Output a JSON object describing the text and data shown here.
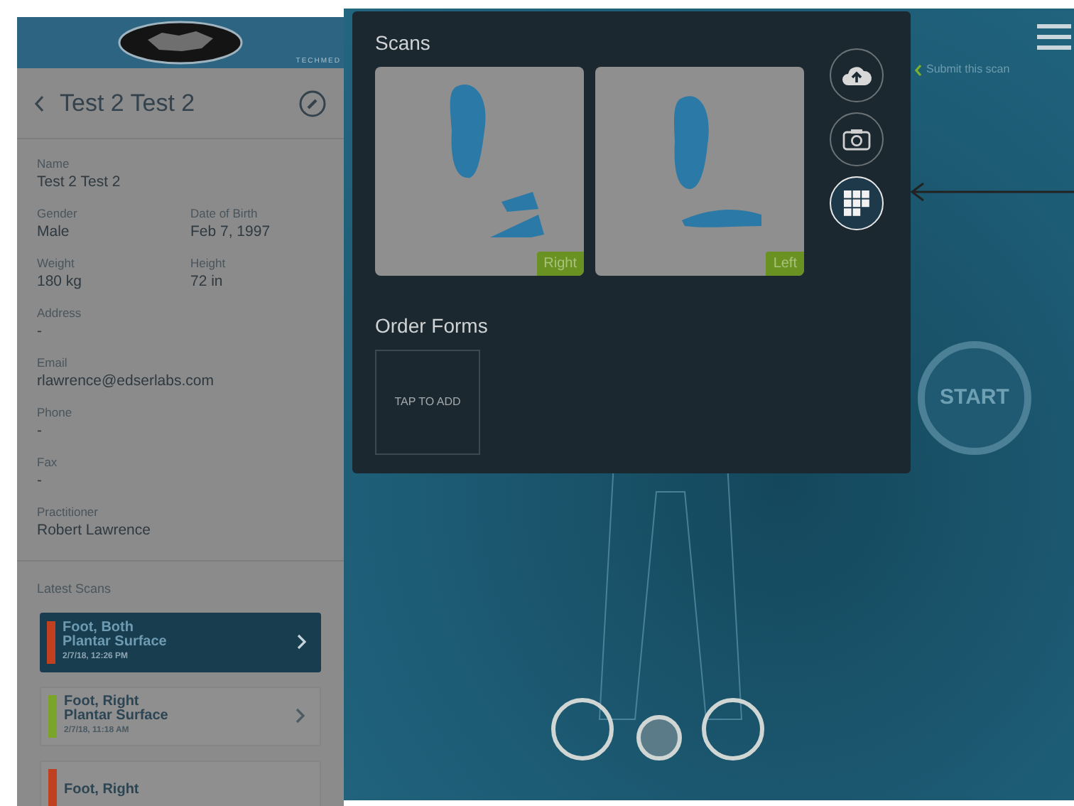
{
  "header": {
    "badge": "TECHMED"
  },
  "patient": {
    "title": "Test 2 Test 2",
    "rows": [
      [
        {
          "label": "Name",
          "value": "Test 2 Test 2"
        }
      ],
      [
        {
          "label": "Gender",
          "value": "Male"
        },
        {
          "label": "Date of Birth",
          "value": "Feb 7, 1997"
        }
      ],
      [
        {
          "label": "Weight",
          "value": "180 kg"
        },
        {
          "label": "Height",
          "value": "72 in"
        }
      ],
      [
        {
          "label": "Address",
          "value": "-"
        }
      ],
      [
        {
          "label": "Email",
          "value": "rlawrence@edserlabs.com"
        }
      ],
      [
        {
          "label": "Phone",
          "value": "-"
        }
      ],
      [
        {
          "label": "Fax",
          "value": "-"
        }
      ],
      [
        {
          "label": "Practitioner",
          "value": "Robert Lawrence"
        }
      ]
    ]
  },
  "latest_scans": {
    "title": "Latest Scans",
    "items": [
      {
        "title": "Foot, Both",
        "subtitle": "Plantar Surface",
        "date": "2/7/18, 12:26 PM",
        "color": "#c0401f",
        "selected": true
      },
      {
        "title": "Foot, Right",
        "subtitle": "Plantar Surface",
        "date": "2/7/18, 11:18 AM",
        "color": "#7aa52a",
        "selected": false
      },
      {
        "title": "Foot, Right",
        "color": "#c0401f",
        "selected": false
      }
    ]
  },
  "scans_panel": {
    "title": "Scans",
    "scans": [
      {
        "label": "Right"
      },
      {
        "label": "Left"
      }
    ],
    "actions": [
      {
        "kind": "upload",
        "selected": false
      },
      {
        "kind": "camera",
        "selected": false
      },
      {
        "kind": "grid",
        "selected": true
      }
    ],
    "order_forms_title": "Order Forms",
    "add_tile": "TAP TO ADD"
  },
  "submit_hint": "Submit this scan",
  "start_button": "START",
  "foot_targets": [
    {
      "kind": "foot",
      "selected": false
    },
    {
      "kind": "center",
      "selected": true
    },
    {
      "kind": "foot",
      "selected": false
    }
  ]
}
